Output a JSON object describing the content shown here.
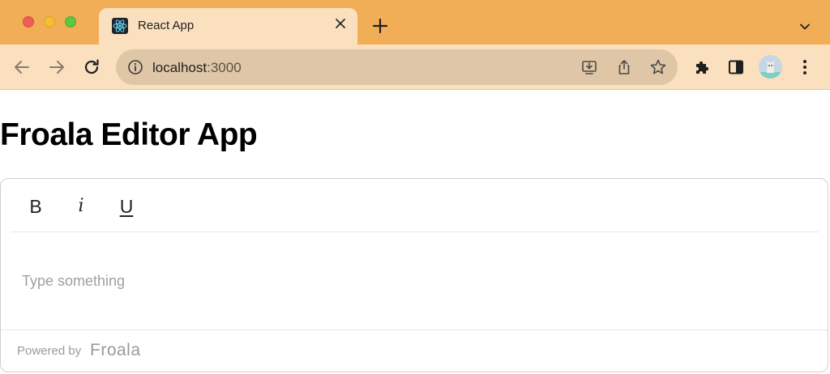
{
  "browser": {
    "tab": {
      "title": "React App",
      "favicon": "react-logo-icon"
    },
    "address": {
      "host": "localhost",
      "port": ":3000"
    },
    "colors": {
      "tabbar": "#f2ae57",
      "toolbar": "#fbe0bf",
      "omnibox": "#dfc6a6"
    }
  },
  "page": {
    "title": "Froala Editor App"
  },
  "editor": {
    "toolbar": {
      "bold_label": "B",
      "italic_label": "i",
      "underline_label": "U"
    },
    "placeholder": "Type something",
    "footer": {
      "powered_by": "Powered by",
      "brand": "Froala"
    }
  }
}
